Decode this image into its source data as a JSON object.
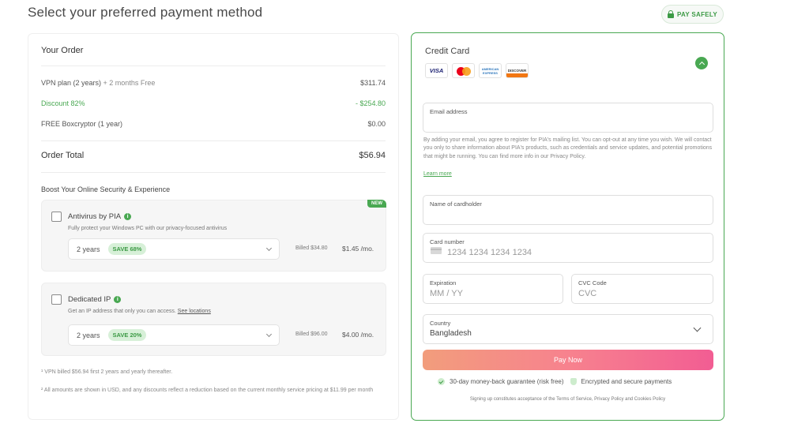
{
  "page": {
    "title": "Select your preferred payment method",
    "pay_safely": "PAY SAFELY"
  },
  "order": {
    "heading": "Your Order",
    "plan_label": "VPN plan (2 years)",
    "plan_extra": "+ 2 months Free",
    "plan_price": "$311.74",
    "discount_label": "Discount 82%",
    "discount_value": "- $254.80",
    "free_label": "FREE Boxcryptor (1 year)",
    "free_value": "$0.00",
    "total_label": "Order Total",
    "total_value": "$56.94"
  },
  "boost": {
    "heading": "Boost Your Online Security & Experience",
    "addons": [
      {
        "name": "Antivirus by PIA",
        "description": "Fully protect your Windows PC with our privacy-focused antivirus",
        "badge": "NEW",
        "period": "2 years",
        "save": "SAVE 68%",
        "billed": "Billed $34.80",
        "price": "$1.45 /mo."
      },
      {
        "name": "Dedicated IP",
        "description": "Get an IP address that only you can access.",
        "link": "See locations",
        "period": "2 years",
        "save": "SAVE 20%",
        "billed": "Billed $96.00",
        "price": "$4.00 /mo."
      }
    ]
  },
  "notes": {
    "first": "¹ VPN billed $56.94 first 2 years and yearly thereafter.",
    "second": "² All amounts are shown in USD, and any discounts reflect a reduction based on the current monthly service pricing at $11.99 per month"
  },
  "credit_card": {
    "title": "Credit Card",
    "cards": [
      "VISA",
      "mastercard",
      "AMERICAN EXPRESS",
      "DISCOVER"
    ],
    "email_label": "Email address",
    "email_value": "",
    "consent": "By adding your email, you agree to register for PIA's mailing list. You can opt-out at any time you wish. We will contact you only to share information about PIA's products, such as credentials and service updates, and potential promotions that might be running. You can find more info in our Privacy Policy.",
    "learn_more": "Learn more",
    "cardholder_label": "Name of cardholder",
    "cardholder_value": "",
    "card_number_label": "Card number",
    "card_number_placeholder": "1234 1234 1234 1234",
    "expiration_label": "Expiration",
    "expiration_placeholder": "MM / YY",
    "cvc_label": "CVC Code",
    "cvc_placeholder": "CVC",
    "country_label": "Country",
    "country_value": "Bangladesh",
    "pay_button": "Pay Now",
    "guarantee": "30-day money-back guarantee (risk free)",
    "encrypted": "Encrypted and secure payments",
    "terms": "Signing up constitutes acceptance of the Terms of Service, Privacy Policy and Cookies Policy"
  },
  "colors": {
    "accent_green": "#49a852",
    "pay_gradient_start": "#f29d7c",
    "pay_gradient_end": "#f25d93"
  }
}
